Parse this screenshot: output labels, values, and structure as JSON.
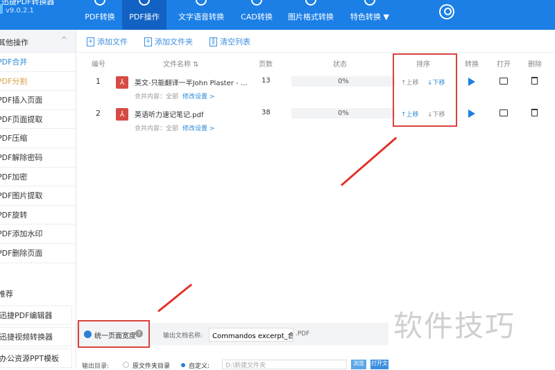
{
  "app": {
    "name": "迅捷PDF转换器",
    "version": "v9.0.2.1"
  },
  "nav": [
    {
      "label": "PDF转换"
    },
    {
      "label": "PDF操作"
    },
    {
      "label": "文字语音转换"
    },
    {
      "label": "CAD转换"
    },
    {
      "label": "图片格式转换"
    },
    {
      "label": "特色转换 ▼"
    }
  ],
  "sidebar": {
    "header": "其他操作",
    "chevron": "^",
    "items": [
      "PDF合并",
      "PDF分割",
      "PDF插入页面",
      "PDF页面提取",
      "PDF压缩",
      "PDF解除密码",
      "PDF加密",
      "PDF图片提取",
      "PDF旋转",
      "PDF添加水印",
      "PDF删除页面"
    ],
    "rec_title": "产品推荐",
    "rec": [
      "迅捷PDF编辑器",
      "迅捷视频转换器",
      "办公资源PPT模板"
    ]
  },
  "toolbar": {
    "add_file": "添加文件",
    "add_folder": "添加文件夹",
    "clear": "清空列表"
  },
  "headers": {
    "no": "编号",
    "name": "文件名称 ⇅",
    "pages": "页数",
    "status": "状态",
    "order": "排序",
    "convert": "转换",
    "open": "打开",
    "delete": "删除"
  },
  "rows": [
    {
      "no": "1",
      "name": "英文-只能翻译一半John Plaster - ...",
      "pages": "13",
      "progress": "0%",
      "sub": "合并内容：全部",
      "edit": "修改设置 >",
      "up": "↑上移",
      "down": "↓下移"
    },
    {
      "no": "2",
      "name": "英语听力速记笔记.pdf",
      "pages": "38",
      "progress": "0%",
      "sub": "合并内容：全部",
      "edit": "修改设置 >",
      "up": "↑上移",
      "down": "↓下移"
    }
  ],
  "options": {
    "unify": "统一页面宽度",
    "help": "?",
    "out_name_label": "输出文档名称:",
    "out_name": "Commandos excerpt_合并",
    "ext": ".PDF",
    "out_dir_label": "输出目录:",
    "orig_dir": "原文件夹目录",
    "custom": "自定义:",
    "path": "D:\\新建文件夹",
    "browse": "浏览",
    "open_folder": "打开文"
  },
  "watermark": "软件技巧"
}
